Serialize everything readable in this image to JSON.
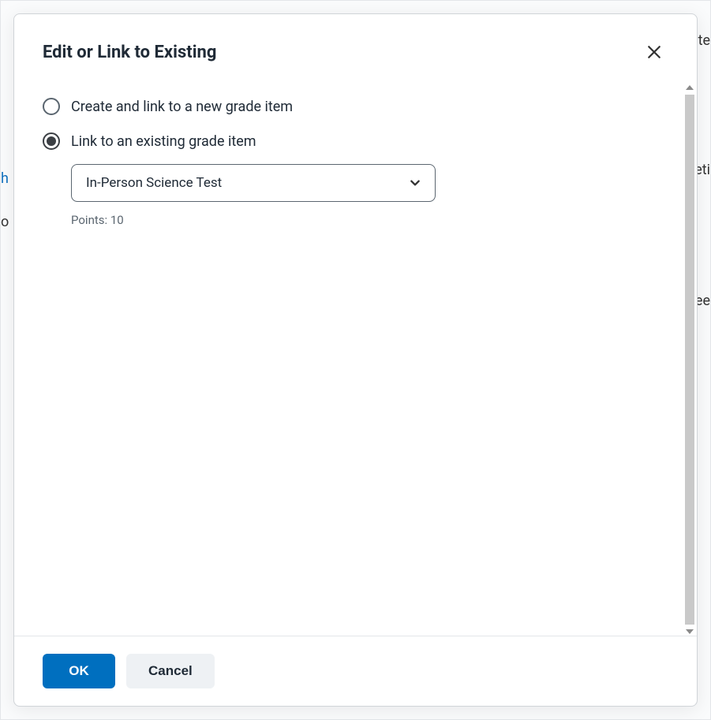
{
  "background": {
    "frag1": "te",
    "frag2": "eti",
    "frag3": "Fee",
    "frag4": "h",
    "frag5": "o"
  },
  "modal": {
    "title": "Edit or Link to Existing",
    "options": {
      "create": {
        "label": "Create and link to a new grade item",
        "selected": false
      },
      "existing": {
        "label": "Link to an existing grade item",
        "selected": true,
        "selected_item": "In-Person Science Test",
        "points_label": "Points: 10"
      }
    },
    "footer": {
      "ok": "OK",
      "cancel": "Cancel"
    }
  }
}
